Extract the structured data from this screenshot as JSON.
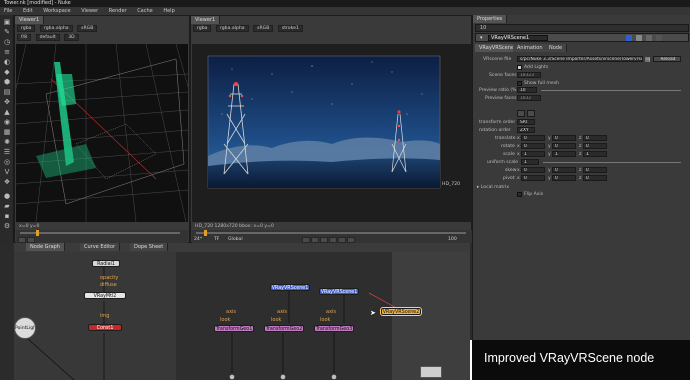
{
  "app": {
    "title": "Tower.nk [modified] - Nuke"
  },
  "menu": [
    "File",
    "Edit",
    "Workspace",
    "Viewer",
    "Render",
    "Cache",
    "Help"
  ],
  "viewer1": {
    "tab": "Viewer1",
    "channels": "rgba",
    "layer": "rgba.alpha",
    "colorspace": "sRGB",
    "mode": "3D",
    "default": "default",
    "status": "x=0 y=0"
  },
  "viewer2": {
    "tab": "Viewer1",
    "channels": "rgba",
    "layer": "rgba.alpha",
    "colorspace": "sRGB",
    "proxy": "stroke1",
    "format_label": "HD_720",
    "status": "HD_720 1280x720  bbox: x=0 y=0",
    "frame": "1"
  },
  "timeline": {
    "fps": "24*",
    "tf": "TF",
    "global": "Global",
    "frame_left": "1",
    "frame_right": "1",
    "end": "100"
  },
  "nodegraph": {
    "tabs": [
      "Node Graph",
      "Curve Editor",
      "Dope Sheet"
    ],
    "nodes": {
      "radial": "Radial1",
      "vraymtl": "VRayMtl2",
      "pointlight": "PointLight",
      "constant": "Const1",
      "vrscene1": "VRayVRScene1",
      "vrscene2": "VRayVRScene1",
      "vrscene3": "VRayVRScene2",
      "tgeo1": "TransformGeo1",
      "tgeo2": "TransformGeo2",
      "tgeo3": "TransformGeo3"
    },
    "labels": {
      "opacity": "opacity",
      "diffuse": "diffuse",
      "img": "img",
      "axis": "axis",
      "look": "look"
    }
  },
  "props": {
    "tab": "Properties",
    "node_name": "VRayVRScene1",
    "sub_tabs": [
      "VRayVRScene",
      "Animation",
      "Node"
    ],
    "vrscene_file_label": "VRscene file",
    "vrscene_file": "s/pc/Nuke 3.3/Scene Importer/Assets/vrscene/Towervrscene",
    "reload": "Reload",
    "add_lights": "Add Lights",
    "scene_faces_label": "Scene faces",
    "scene_faces": "18323",
    "show_full_mesh": "Show full mesh",
    "preview_ratio_label": "Preview ratio (%)",
    "preview_ratio": "10",
    "preview_faces_label": "Preview faces",
    "preview_faces": "1832",
    "transform_order_label": "transform order",
    "transform_order": "SRT",
    "rotation_order_label": "rotation order",
    "rotation_order": "ZXY",
    "translate_label": "translate",
    "rotate_label": "rotate",
    "scale_label": "scale",
    "uniform_scale_label": "uniform scale",
    "skew_label": "skew",
    "pivot_label": "pivot",
    "x": "x",
    "y": "y",
    "z": "z",
    "zero": "0",
    "one": "1",
    "local_matrix": "Local matrix",
    "flip_axis": "Flip Axis"
  },
  "caption": "Improved VRayVRScene node"
}
